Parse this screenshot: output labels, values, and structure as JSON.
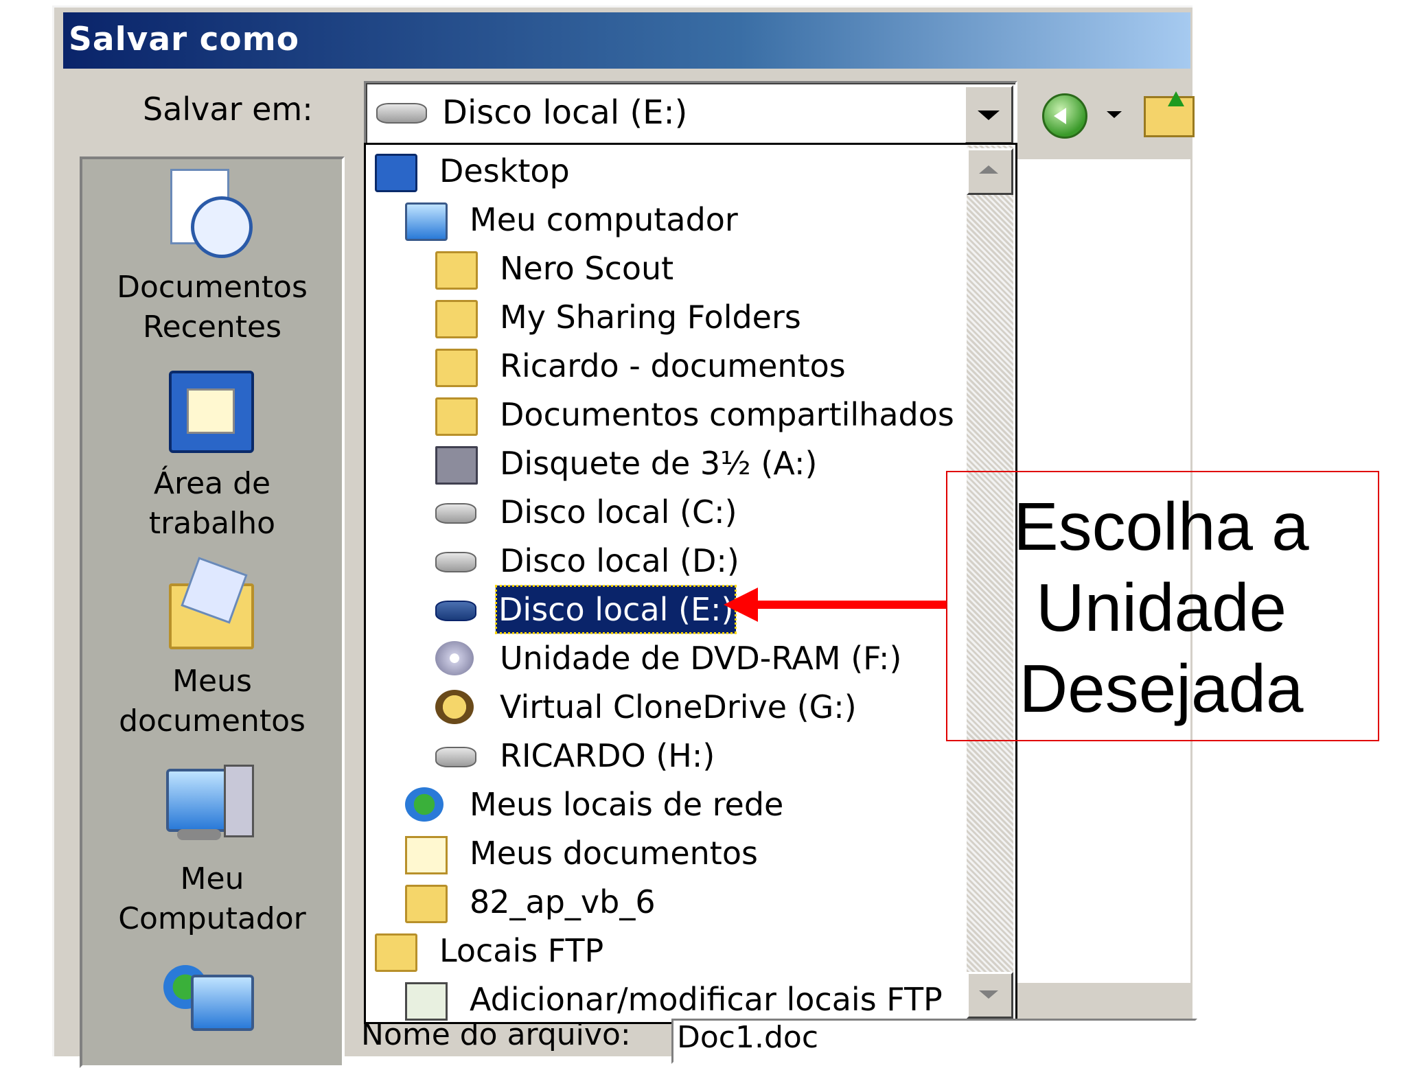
{
  "window": {
    "title": "Salvar como"
  },
  "toolbar": {
    "save_in_label": "Salvar em:",
    "location_value": "Disco local (E:)"
  },
  "places": [
    {
      "label1": "Documentos",
      "label2": "Recentes",
      "icon": "recent-documents-icon"
    },
    {
      "label1": "Área de",
      "label2": "trabalho",
      "icon": "desktop-icon"
    },
    {
      "label1": "Meus",
      "label2": "documentos",
      "icon": "my-documents-icon"
    },
    {
      "label1": "Meu",
      "label2": "Computador",
      "icon": "my-computer-icon"
    },
    {
      "label1": "",
      "label2": "",
      "icon": "network-places-icon"
    }
  ],
  "dropdown": {
    "items": [
      {
        "label": "Desktop",
        "icon": "desktop-icon",
        "level": 0
      },
      {
        "label": "Meu computador",
        "icon": "computer-icon",
        "level": 1
      },
      {
        "label": "Nero Scout",
        "icon": "nero-scout-icon",
        "level": 2
      },
      {
        "label": "My Sharing Folders",
        "icon": "sharing-folder-icon",
        "level": 2
      },
      {
        "label": "Ricardo - documentos",
        "icon": "folder-icon",
        "level": 2
      },
      {
        "label": "Documentos compartilhados",
        "icon": "folder-icon",
        "level": 2
      },
      {
        "label": "Disquete de 3½ (A:)",
        "icon": "floppy-drive-icon",
        "level": 2
      },
      {
        "label": "Disco local (C:)",
        "icon": "hard-drive-icon",
        "level": 2
      },
      {
        "label": "Disco local (D:)",
        "icon": "hard-drive-icon",
        "level": 2
      },
      {
        "label": "Disco local (E:)",
        "icon": "hard-drive-icon",
        "level": 2,
        "selected": true
      },
      {
        "label": "Unidade de DVD-RAM (F:)",
        "icon": "dvd-drive-icon",
        "level": 2
      },
      {
        "label": "Virtual CloneDrive (G:)",
        "icon": "clonedrive-icon",
        "level": 2
      },
      {
        "label": "RICARDO (H:)",
        "icon": "removable-drive-icon",
        "level": 2
      },
      {
        "label": "Meus locais de rede",
        "icon": "network-icon",
        "level": 1
      },
      {
        "label": "Meus documentos",
        "icon": "my-documents-icon",
        "level": 1
      },
      {
        "label": "82_ap_vb_6",
        "icon": "folder-icon",
        "level": 1
      },
      {
        "label": "Locais FTP",
        "icon": "folder-icon",
        "level": 0
      },
      {
        "label": "Adicionar/modificar locais FTP",
        "icon": "ftp-icon",
        "level": 1
      }
    ]
  },
  "filename": {
    "label": "Nome do arquivo:",
    "value": "Doc1.doc"
  },
  "callout": {
    "line1": "Escolha a",
    "line2": "Unidade",
    "line3": "Desejada",
    "color": "#ff0000"
  }
}
